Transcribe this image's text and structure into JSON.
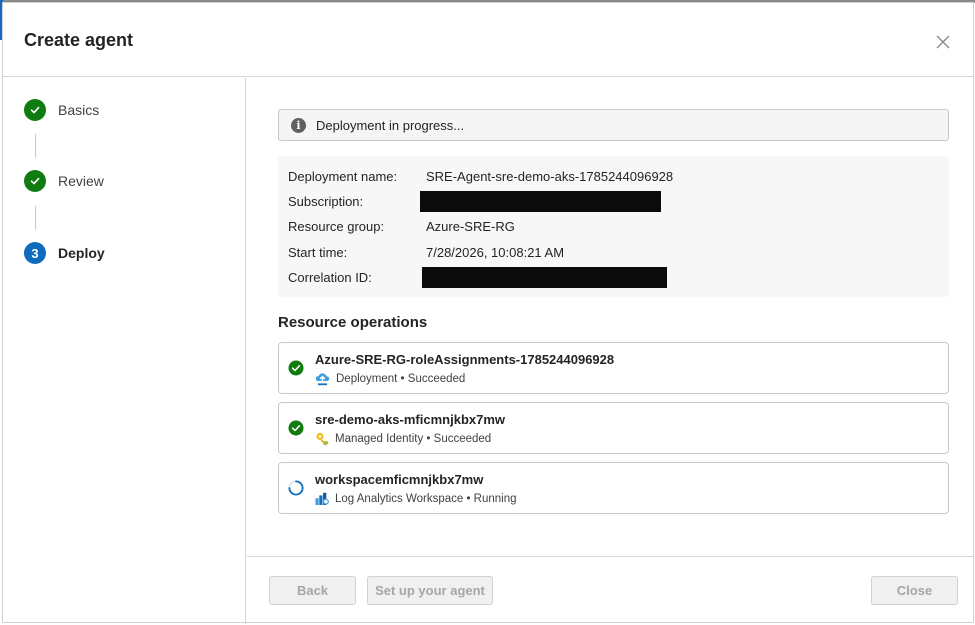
{
  "dialog": {
    "title": "Create agent",
    "close_icon": "close-icon"
  },
  "steps": [
    {
      "label": "Basics",
      "state": "done",
      "icon": "checkmark-icon"
    },
    {
      "label": "Review",
      "state": "done",
      "icon": "checkmark-icon"
    },
    {
      "label": "Deploy",
      "state": "current",
      "number": "3"
    }
  ],
  "status_banner": {
    "icon": "info-icon",
    "text": "Deployment in progress..."
  },
  "details": {
    "deployment_name_label": "Deployment name:",
    "deployment_name": "SRE-Agent-sre-demo-aks-1785244096928",
    "subscription_label": "Subscription:",
    "resource_group_label": "Resource group:",
    "resource_group": "Azure-SRE-RG",
    "start_time_label": "Start time:",
    "start_time": "7/28/2026, 10:08:21 AM",
    "correlation_id_label": "Correlation ID:"
  },
  "resource_operations": {
    "title": "Resource operations",
    "items": [
      {
        "name": "Azure-SRE-RG-roleAssignments-1785244096928",
        "detail": "Deployment • Succeeded",
        "status": "succeeded",
        "type_icon": "deployment-icon"
      },
      {
        "name": "sre-demo-aks-mficmnjkbx7mw",
        "detail": "Managed Identity • Succeeded",
        "status": "succeeded",
        "type_icon": "managed-identity-icon"
      },
      {
        "name": "workspacemficmnjkbx7mw",
        "detail": "Log Analytics Workspace • Running",
        "status": "running",
        "type_icon": "log-analytics-icon"
      }
    ]
  },
  "footer": {
    "back_label": "Back",
    "setup_label": "Set up your agent",
    "close_label": "Close"
  },
  "colors": {
    "success": "#107c10",
    "accent": "#0f6cbd",
    "redaction": "#0b0b0b"
  }
}
